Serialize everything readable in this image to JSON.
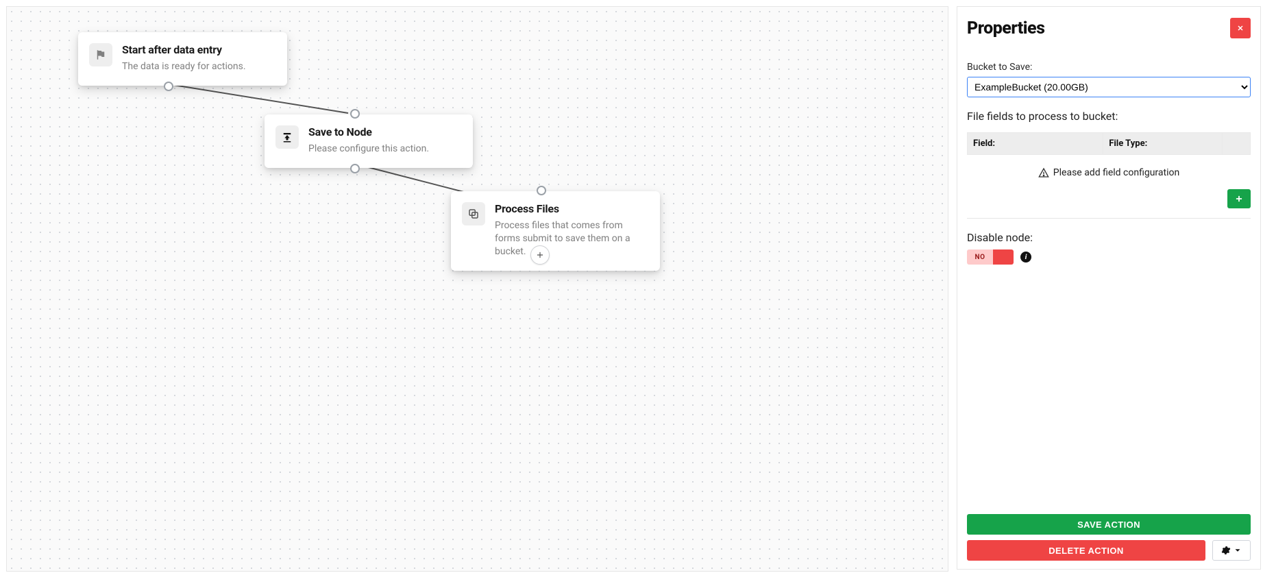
{
  "canvas": {
    "nodes": {
      "start": {
        "title": "Start after data entry",
        "subtitle": "The data is ready for actions.",
        "icon": "flag-icon"
      },
      "save": {
        "title": "Save to Node",
        "subtitle": "Please configure this action.",
        "icon": "download-icon"
      },
      "process": {
        "title": "Process Files",
        "subtitle": "Process files that comes from forms submit to save them on a bucket.",
        "icon": "copy-icon"
      }
    }
  },
  "panel": {
    "title": "Properties",
    "bucket_label": "Bucket to Save:",
    "bucket_selected": "ExampleBucket (20.00GB)",
    "file_fields_label": "File fields to process to bucket:",
    "table": {
      "col_field": "Field:",
      "col_type": "File Type:",
      "empty_msg": "Please add field configuration"
    },
    "disable_node_label": "Disable node:",
    "disable_node": {
      "value": "NO"
    },
    "actions": {
      "save": "SAVE ACTION",
      "delete": "DELETE ACTION"
    }
  },
  "colors": {
    "green": "#16a34a",
    "red": "#ef4444"
  }
}
